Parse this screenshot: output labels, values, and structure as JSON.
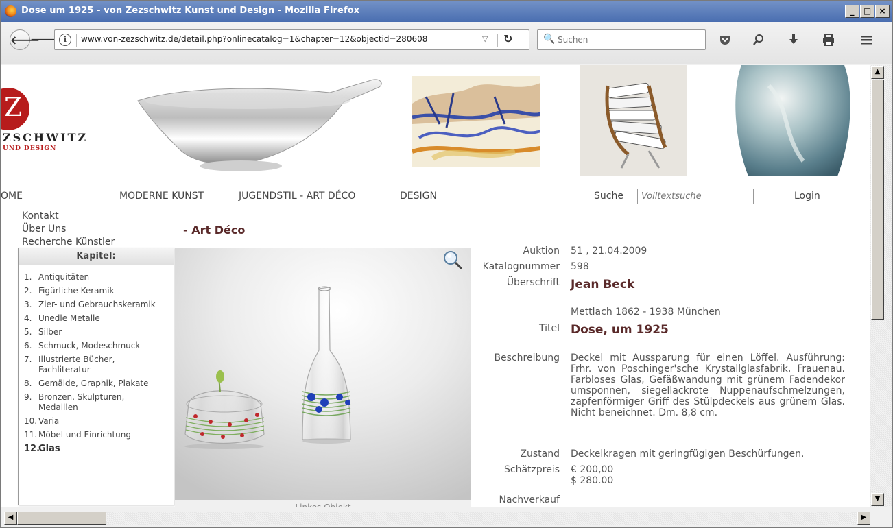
{
  "window": {
    "title": "Dose um 1925 - von Zezschwitz Kunst und Design - Mozilla Firefox",
    "minimize": "_",
    "maximize": "□",
    "close": "×"
  },
  "browser": {
    "url": "www.von-zezschwitz.de/detail.php?onlinecatalog=1&chapter=12&objectid=280608",
    "search_placeholder": "Suchen",
    "icons": [
      "back-icon",
      "forward-icon",
      "info-icon",
      "dropdown-icon",
      "reload-icon",
      "search-icon",
      "pocket-icon",
      "zoom-icon",
      "download-icon",
      "print-icon",
      "menu-icon"
    ]
  },
  "logo": {
    "letter": "Z",
    "name": "ZSCHWITZ",
    "sub": "UND DESIGN"
  },
  "nav": {
    "items": [
      "OME",
      "MODERNE KUNST",
      "JUGENDSTIL - ART DÉCO",
      "DESIGN"
    ],
    "search_label": "Suche",
    "search_placeholder": "Volltextsuche",
    "login": "Login"
  },
  "sidebar": {
    "links": [
      "Kontakt",
      "Über Uns",
      "Recherche Künstler"
    ]
  },
  "page_title": "- Art Déco",
  "kapitel": {
    "title": "Kapitel:",
    "items": [
      {
        "num": "1.",
        "label": "Antiquitäten"
      },
      {
        "num": "2.",
        "label": "Figürliche Keramik"
      },
      {
        "num": "3.",
        "label": "Zier- und Gebrauchskeramik"
      },
      {
        "num": "4.",
        "label": "Unedle Metalle"
      },
      {
        "num": "5.",
        "label": "Silber"
      },
      {
        "num": "6.",
        "label": "Schmuck, Modeschmuck"
      },
      {
        "num": "7.",
        "label": "Illustrierte Bücher, Fachliteratur"
      },
      {
        "num": "8.",
        "label": "Gemälde, Graphik, Plakate"
      },
      {
        "num": "9.",
        "label": "Bronzen, Skulpturen, Medaillen"
      },
      {
        "num": "10.",
        "label": "Varia"
      },
      {
        "num": "11.",
        "label": "Möbel und Einrichtung"
      },
      {
        "num": "12.",
        "label": "Glas"
      }
    ],
    "active_index": 11
  },
  "image_caption": "Linkes Objekt",
  "details": {
    "auktion_label": "Auktion",
    "auktion": "51 , 21.04.2009",
    "katalog_label": "Katalognummer",
    "katalog": "598",
    "ueberschrift_label": "Überschrift",
    "ueberschrift": "Jean Beck",
    "lebensdaten": "Mettlach 1862 - 1938 München",
    "titel_label": "Titel",
    "titel": "Dose, um 1925",
    "beschreibung_label": "Beschreibung",
    "beschreibung": "Deckel mit Aussparung für einen Löffel. Ausführung: Frhr. von Poschinger'sche Krystallglasfabrik, Frauenau. Farbloses Glas, Gefäßwandung mit grünem Fadendekor umsponnen, siegellackrote Nuppenaufschmelzungen, zapfenförmiger Griff des Stülpdeckels aus grünem Glas. Nicht beneichnet. Dm. 8,8 cm.",
    "zustand_label": "Zustand",
    "zustand": "Deckelkragen mit geringfügigen Beschürfungen.",
    "schaetzpreis_label": "Schätzpreis",
    "schaetzpreis_eur": "€ 200,00",
    "schaetzpreis_usd": "$ 280.00",
    "nachverkauf_label": "Nachverkauf"
  }
}
